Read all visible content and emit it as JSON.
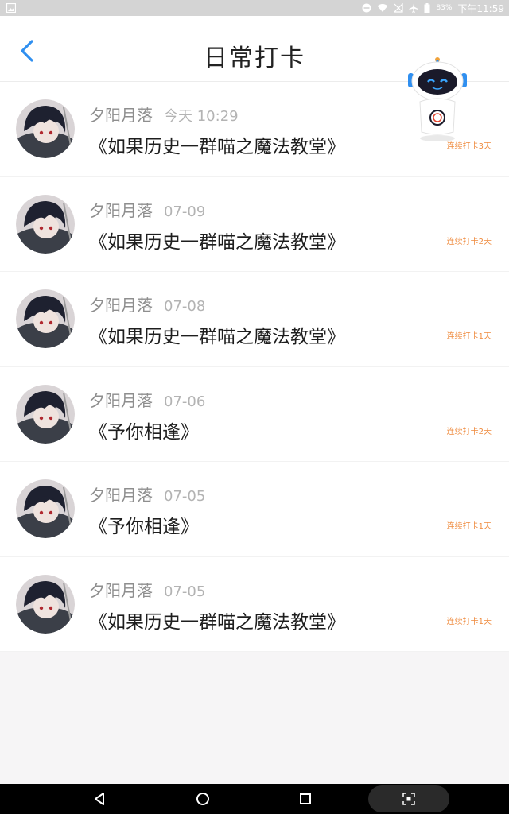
{
  "status_bar": {
    "battery": "83%",
    "time": "下午11:59"
  },
  "header": {
    "title": "日常打卡"
  },
  "colors": {
    "accent": "#2f8ff0",
    "streak": "#ef8a3c"
  },
  "records": [
    {
      "user": "夕阳月落",
      "date": "今天 10:29",
      "book": "《如果历史一群喵之魔法教堂》",
      "streak": "连续打卡3天"
    },
    {
      "user": "夕阳月落",
      "date": "07-09",
      "book": "《如果历史一群喵之魔法教堂》",
      "streak": "连续打卡2天"
    },
    {
      "user": "夕阳月落",
      "date": "07-08",
      "book": "《如果历史一群喵之魔法教堂》",
      "streak": "连续打卡1天"
    },
    {
      "user": "夕阳月落",
      "date": "07-06",
      "book": "《予你相逢》",
      "streak": "连续打卡2天"
    },
    {
      "user": "夕阳月落",
      "date": "07-05",
      "book": "《予你相逢》",
      "streak": "连续打卡1天"
    },
    {
      "user": "夕阳月落",
      "date": "07-05",
      "book": "《如果历史一群喵之魔法教堂》",
      "streak": "连续打卡1天"
    }
  ]
}
